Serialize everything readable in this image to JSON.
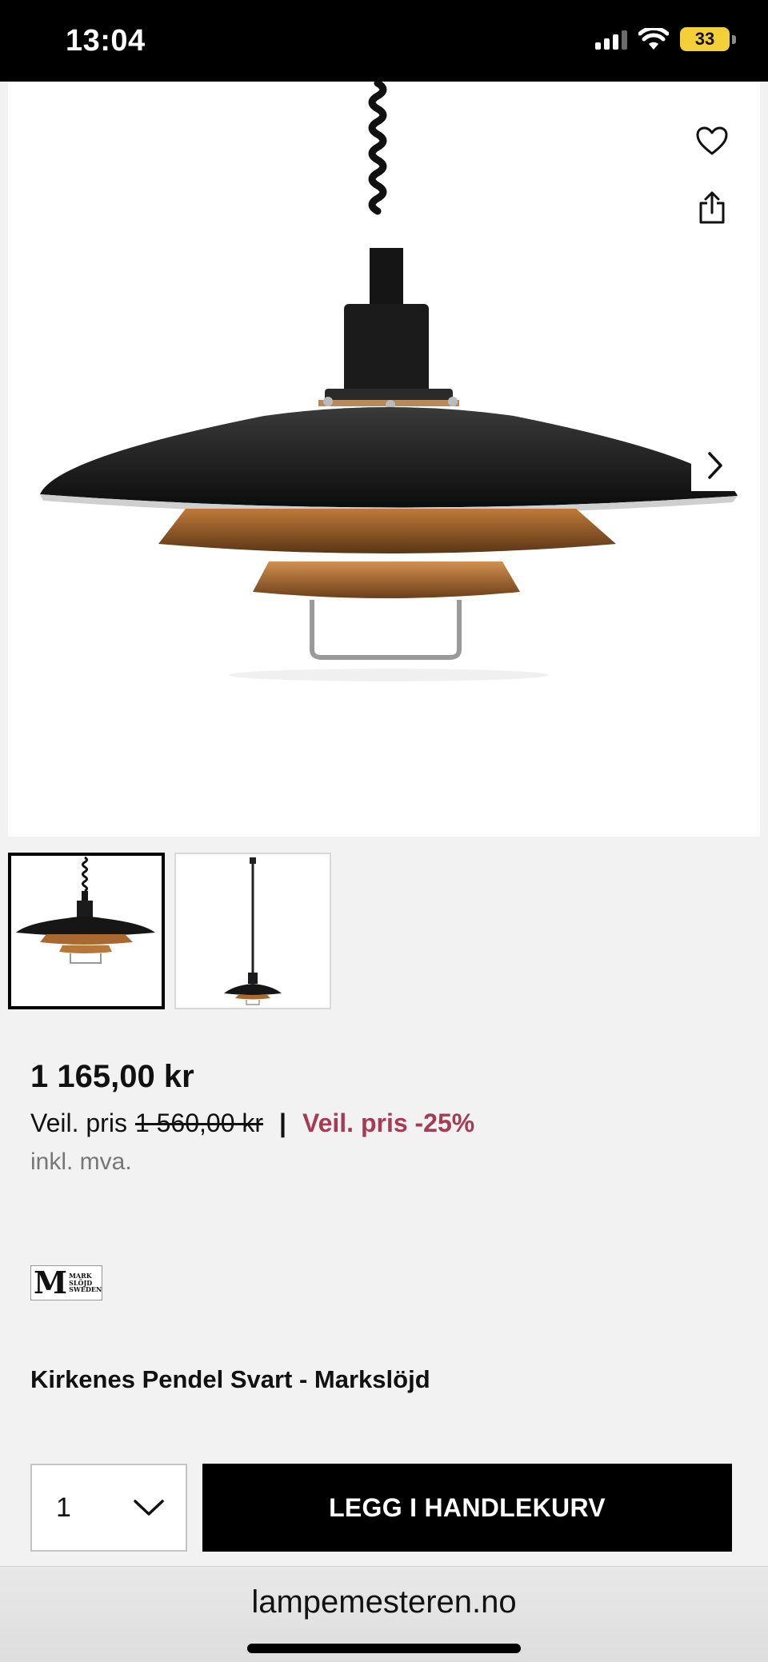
{
  "status_bar": {
    "time": "13:04",
    "battery": "33"
  },
  "product": {
    "price": "1 165,00 kr",
    "list_price_label": "Veil. pris",
    "list_price": "1 560,00 kr",
    "separator": "|",
    "discount_label": "Veil. pris -25%",
    "vat_note": "inkl. mva.",
    "brand_logo_text": "MARK SLÖJD SWEDEN",
    "title": "Kirkenes Pendel Svart - Markslöjd"
  },
  "purchase": {
    "quantity": "1",
    "add_to_cart_label": "LEGG I HANDLEKURV"
  },
  "browser": {
    "url": "lampemesteren.no"
  },
  "gallery": {
    "thumbnail_count": 2,
    "active_index": 0
  },
  "icons": [
    "heart-icon",
    "share-icon",
    "chevron-right-icon",
    "chevron-down-icon",
    "wifi-icon",
    "signal-icon",
    "battery-icon"
  ],
  "colors": {
    "discount": "#a53c54",
    "button_bg": "#000000",
    "page_bg": "#f2f2f2"
  }
}
